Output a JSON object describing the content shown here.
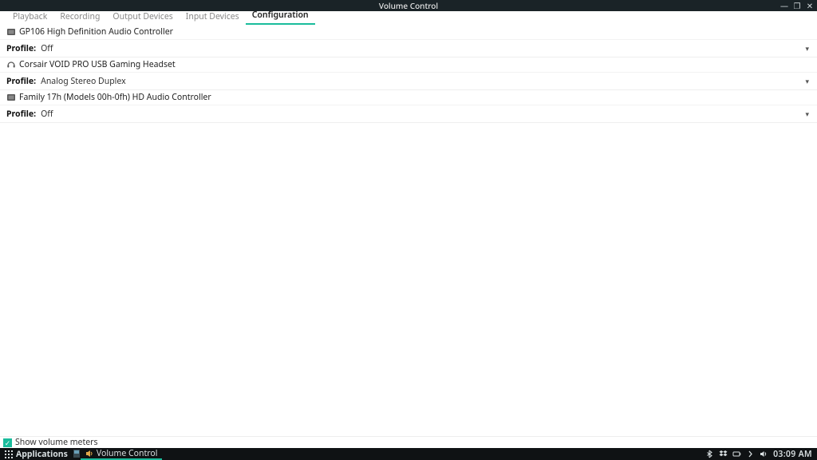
{
  "window": {
    "title": "Volume Control",
    "minimize": "—",
    "maximize": "❐",
    "close": "✕"
  },
  "tabs": [
    {
      "label": "Playback",
      "active": false
    },
    {
      "label": "Recording",
      "active": false
    },
    {
      "label": "Output Devices",
      "active": false
    },
    {
      "label": "Input Devices",
      "active": false
    },
    {
      "label": "Configuration",
      "active": true
    }
  ],
  "profile_label": "Profile:",
  "devices": [
    {
      "icon": "card",
      "name": "GP106 High Definition Audio Controller",
      "profile": "Off"
    },
    {
      "icon": "headset",
      "name": "Corsair VOID PRO USB Gaming Headset",
      "profile": "Analog Stereo Duplex"
    },
    {
      "icon": "card",
      "name": "Family 17h (Models 00h-0fh) HD Audio Controller",
      "profile": "Off"
    }
  ],
  "footer": {
    "show_meters": "Show volume meters",
    "checked": true
  },
  "taskbar": {
    "launcher": "Applications",
    "task_title": "Volume Control",
    "clock": "03:09 AM"
  }
}
